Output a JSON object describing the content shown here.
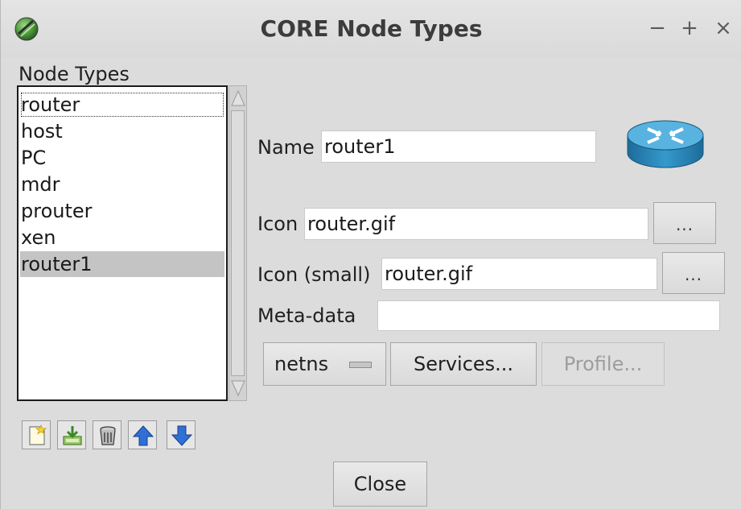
{
  "window": {
    "title": "CORE Node Types",
    "controls": {
      "minimize": "−",
      "maximize": "+",
      "close": "×"
    }
  },
  "node_types": {
    "label": "Node Types",
    "items": [
      "router",
      "host",
      "PC",
      "mdr",
      "prouter",
      "xen",
      "router1"
    ],
    "active_index": 0,
    "selected_index": 6
  },
  "toolbar": {
    "icons": [
      "new-node-type-icon",
      "save-node-type-icon",
      "delete-node-type-icon",
      "move-up-icon",
      "move-down-icon"
    ]
  },
  "form": {
    "name": {
      "label": "Name",
      "value": "router1"
    },
    "icon": {
      "label": "Icon",
      "value": "router.gif",
      "browse": "..."
    },
    "icon_small": {
      "label": "Icon (small)",
      "value": "router.gif",
      "browse": "..."
    },
    "metadata": {
      "label": "Meta-data",
      "value": ""
    },
    "model_menu": {
      "value": "netns"
    },
    "services_button": "Services...",
    "profile_button": "Profile..."
  },
  "footer": {
    "close_button": "Close"
  },
  "colors": {
    "window_bg": "#dcdcdc",
    "selection_bg": "#c4c4c4",
    "arrow_blue": "#2f6fd6",
    "router_blue": "#2f87b8"
  }
}
